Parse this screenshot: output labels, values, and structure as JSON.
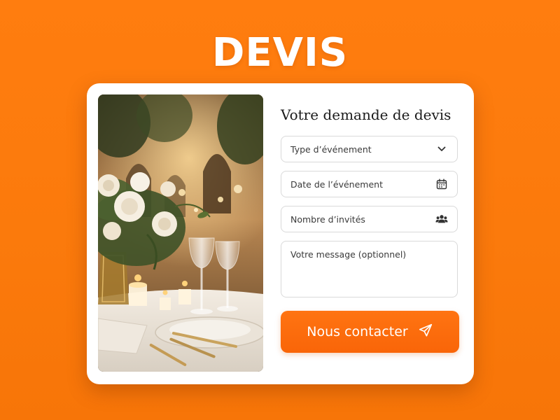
{
  "page": {
    "title": "DEVIS"
  },
  "form": {
    "title": "Votre demande de devis",
    "event_type": {
      "placeholder": "Type d’événement",
      "icon": "chevron-down-icon"
    },
    "event_date": {
      "placeholder": "Date de l’événement",
      "icon": "calendar-icon"
    },
    "guests": {
      "placeholder": "Nombre d’invités",
      "icon": "people-icon"
    },
    "message": {
      "placeholder": "Votre message (optionnel)"
    },
    "submit": {
      "label": "Nous contacter",
      "icon": "send-icon"
    }
  },
  "colors": {
    "background": "#fb7a0c",
    "card": "#ffffff",
    "accent": "#fa6a0a",
    "field_border": "#d9d9d9",
    "text": "#1b1b1b"
  }
}
